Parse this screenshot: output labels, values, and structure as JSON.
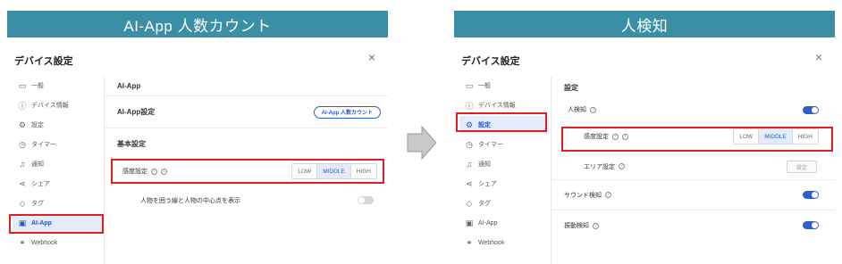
{
  "left": {
    "banner": "AI-App 人数カウント",
    "title": "デバイス設定",
    "close": "×",
    "sidebar": [
      {
        "label": "一般",
        "icon": "general-icon",
        "glyph": "▭"
      },
      {
        "label": "デバイス情報",
        "icon": "info-icon",
        "glyph": "ⓘ"
      },
      {
        "label": "設定",
        "icon": "gear-icon",
        "glyph": "⚙"
      },
      {
        "label": "タイマー",
        "icon": "timer-icon",
        "glyph": "◷"
      },
      {
        "label": "通知",
        "icon": "bell-icon",
        "glyph": "♫"
      },
      {
        "label": "シェア",
        "icon": "share-icon",
        "glyph": "⋖"
      },
      {
        "label": "タグ",
        "icon": "tag-icon",
        "glyph": "◇"
      },
      {
        "label": "AI-App",
        "icon": "ai-app-icon",
        "glyph": "▣"
      },
      {
        "label": "Webhook",
        "icon": "webhook-icon",
        "glyph": "⚭"
      }
    ],
    "section_header": "AI-App",
    "app_setting_label": "AI-App設定",
    "app_setting_button": "AI-App 人数カウント",
    "basic_setting_label": "基本設定",
    "sensitivity_label": "感度設定",
    "sensitivity_options": [
      "LOW",
      "MIDDLE",
      "HIGH"
    ],
    "display_label": "人物を囲う線と人物の中心点を表示"
  },
  "right": {
    "banner": "人検知",
    "title": "デバイス設定",
    "close": "×",
    "sidebar": [
      {
        "label": "一般",
        "icon": "general-icon",
        "glyph": "▭"
      },
      {
        "label": "デバイス情報",
        "icon": "info-icon",
        "glyph": "ⓘ"
      },
      {
        "label": "設定",
        "icon": "gear-icon",
        "glyph": "⚙"
      },
      {
        "label": "タイマー",
        "icon": "timer-icon",
        "glyph": "◷"
      },
      {
        "label": "通知",
        "icon": "bell-icon",
        "glyph": "♫"
      },
      {
        "label": "シェア",
        "icon": "share-icon",
        "glyph": "⋖"
      },
      {
        "label": "タグ",
        "icon": "tag-icon",
        "glyph": "◇"
      },
      {
        "label": "AI-App",
        "icon": "ai-app-icon",
        "glyph": "▣"
      },
      {
        "label": "Webhook",
        "icon": "webhook-icon",
        "glyph": "⚭"
      }
    ],
    "section_header": "設定",
    "person_detect_label": "人検知",
    "sensitivity_label": "感度設定",
    "sensitivity_options": [
      "LOW",
      "MIDDLE",
      "HIGH"
    ],
    "area_label": "エリア設定",
    "area_button": "設定",
    "sound_label": "サウンド検知",
    "motion_label": "振動検知"
  },
  "colors": {
    "banner": "#3a8fa7",
    "accent": "#2d5fc9",
    "highlight": "#e02020"
  }
}
